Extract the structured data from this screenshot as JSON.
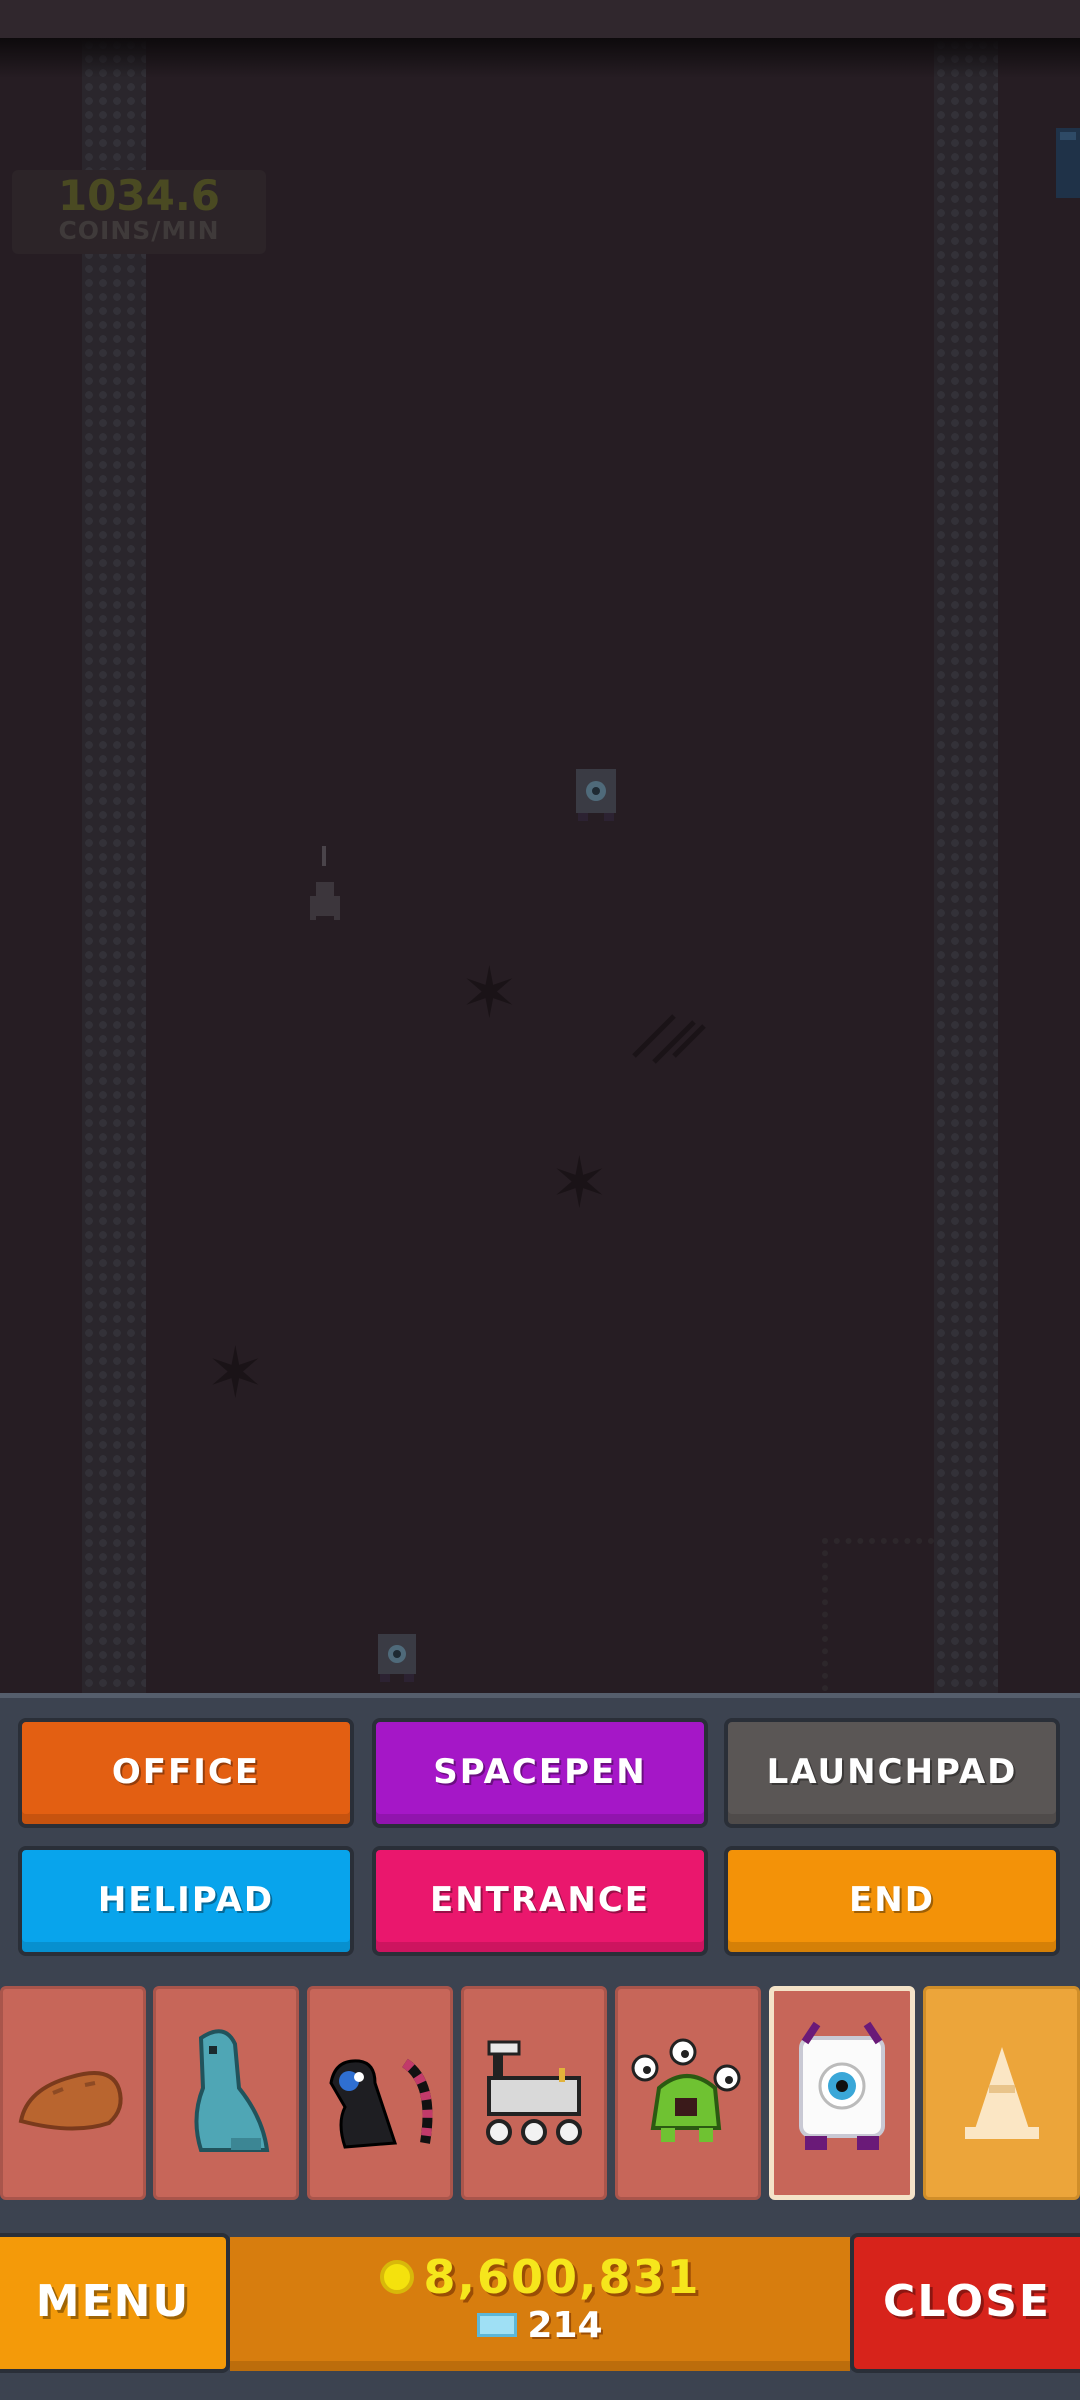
{
  "hud": {
    "rate_value": "1034.6",
    "rate_unit": "COINS/MIN"
  },
  "buttons": {
    "office": "OFFICE",
    "spacepen": "SPACEPEN",
    "launchpad": "LAUNCHPAD",
    "helipad": "HELIPAD",
    "entrance": "ENTRANCE",
    "end": "END"
  },
  "items": [
    {
      "icon": "rock-icon"
    },
    {
      "icon": "seal-creature-icon"
    },
    {
      "icon": "monkey-creature-icon"
    },
    {
      "icon": "mars-rover-icon"
    },
    {
      "icon": "green-alien-icon"
    },
    {
      "icon": "eyeball-robot-icon",
      "selected": true
    },
    {
      "icon": "traffic-cone-icon"
    }
  ],
  "bottom_bar": {
    "menu_label": "MENU",
    "coins": "8,600,831",
    "gems": "214",
    "close_label": "CLOSE"
  },
  "colors": {
    "office": "#e35f12",
    "spacepen": "#a517c7",
    "launchpad": "#5a5655",
    "helipad": "#08a4ec",
    "entrance": "#ea176d",
    "end": "#f39208",
    "item_bg": "#c76659"
  }
}
